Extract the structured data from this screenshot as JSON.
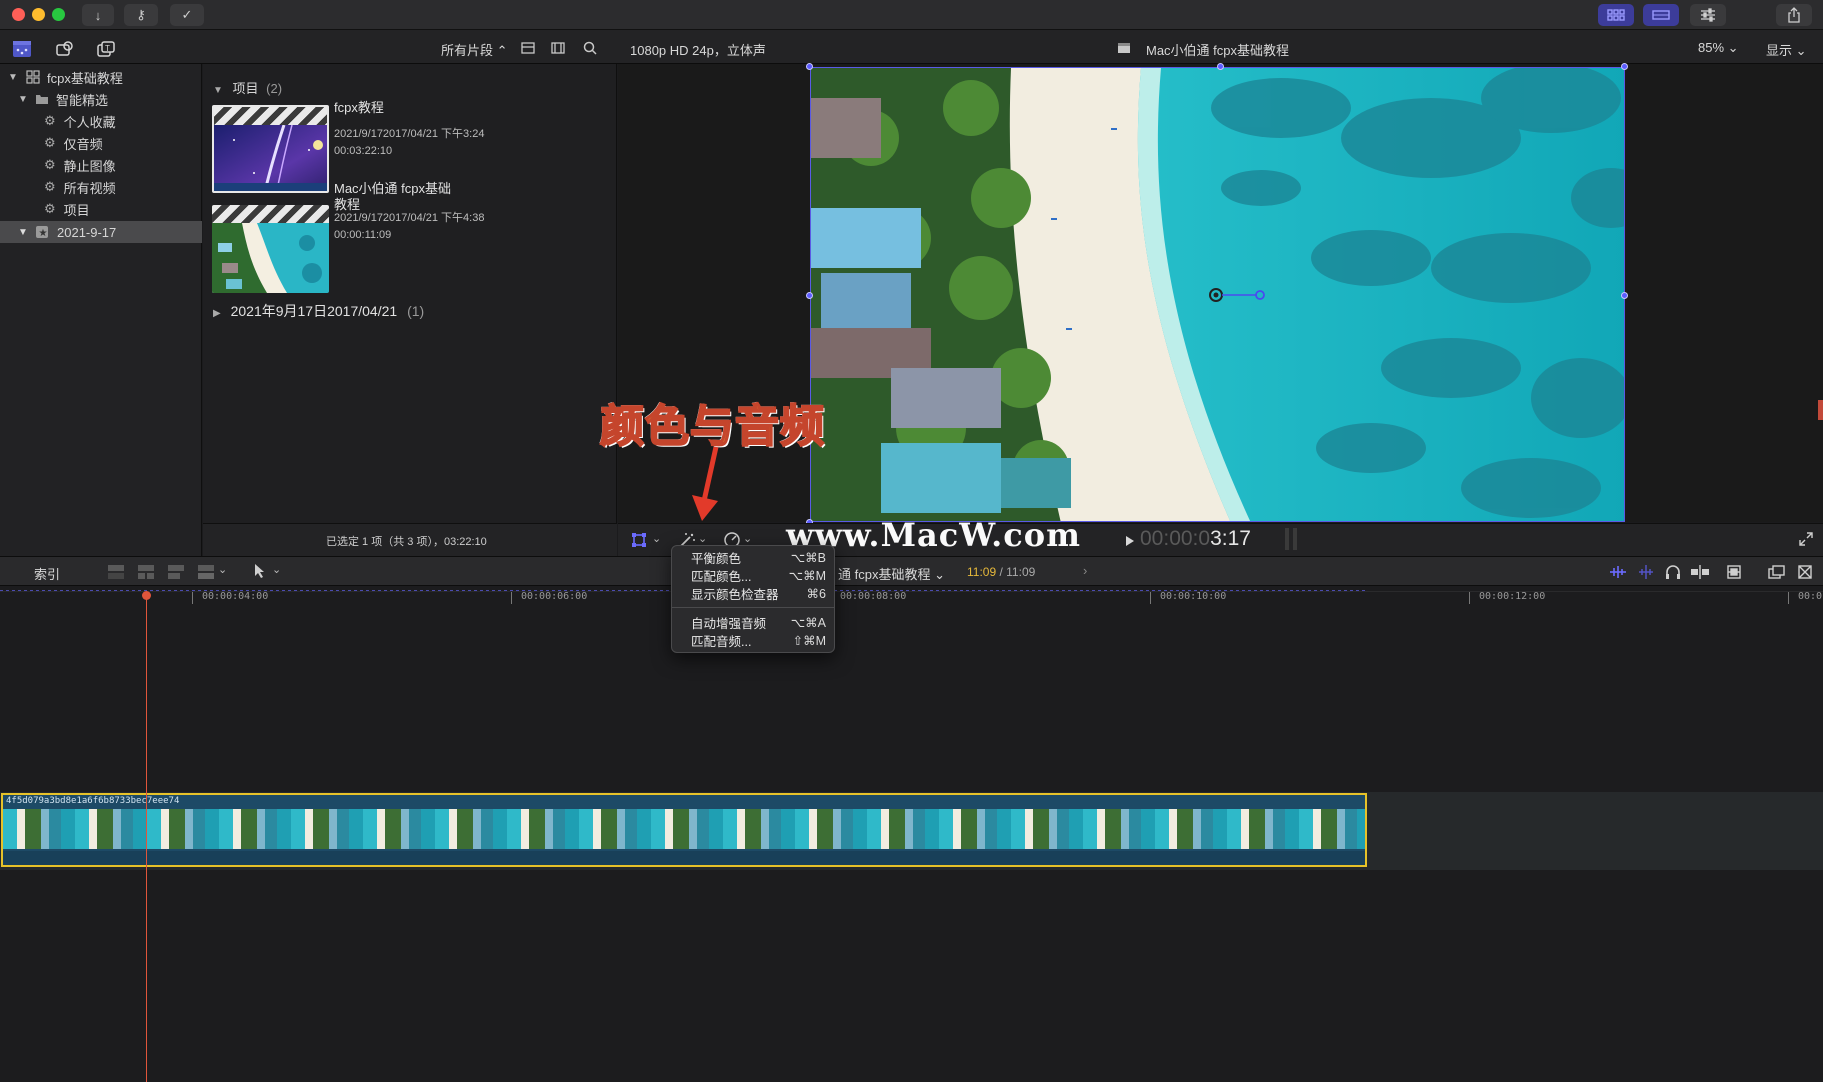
{
  "titlebar": {
    "traffic": [
      "#fe5f57",
      "#febc2e",
      "#28c840"
    ],
    "buttons": [
      "↓",
      "⚷",
      "✓"
    ],
    "right_icons": [
      "grid-icon",
      "filmstrip-icon",
      "sliders-icon",
      "share-icon"
    ]
  },
  "toolbar": {
    "clips_filter": "所有片段 ⌃",
    "viewer_format": "1080p HD 24p，立体声",
    "viewer_title": "Mac小伯通 fcpx基础教程",
    "zoom": "85% ⌄",
    "display": "显示 ⌄"
  },
  "sidebar": {
    "library": "fcpx基础教程",
    "smart_folder": "智能精选",
    "items": [
      "个人收藏",
      "仅音频",
      "静止图像",
      "所有视频",
      "项目"
    ],
    "event": "2021-9-17"
  },
  "browser": {
    "section_title": "项目",
    "section_count": "(2)",
    "clips": [
      {
        "name": "fcpx教程",
        "date": "2021/9/172017/04/21 下午3:24",
        "duration": "00:03:22:10"
      },
      {
        "name": "Mac小伯通 fcpx基础\n教程",
        "date": "2021/9/172017/04/21 下午4:38",
        "duration": "00:00:11:09"
      }
    ],
    "collapsed_section": "2021年9月17日2017/04/21",
    "collapsed_count": "(1)",
    "status": "已选定 1 项（共 3 项），03:22:10"
  },
  "viewer": {
    "timecode_dim": "00:00:0",
    "timecode": "3:17"
  },
  "timeline": {
    "index_label": "索引",
    "project_name": "通 fcpx基础教程 ⌄",
    "position": "11:09",
    "duration": "/ 11:09",
    "ruler": [
      "00:00:04:00",
      "00:00:06:00",
      "00:00:08:00",
      "00:00:10:00",
      "00:00:12:00",
      "00:0"
    ],
    "clip_name": "4f5d079a3bd8e1a6f6b8733bec7eee74"
  },
  "menu": {
    "items": [
      {
        "label": "平衡颜色",
        "shortcut": "⌥⌘B"
      },
      {
        "label": "匹配颜色...",
        "shortcut": "⌥⌘M"
      },
      {
        "label": "显示颜色检查器",
        "shortcut": "⌘6"
      },
      {
        "label": "自动增强音频",
        "shortcut": "⌥⌘A"
      },
      {
        "label": "匹配音频...",
        "shortcut": "⇧⌘M"
      }
    ]
  },
  "annotation": {
    "text": "颜色与音频",
    "watermark": "www.MacW.com"
  },
  "colors": {
    "accent": "#5c5cff",
    "playhead": "#e0553b",
    "clip_border": "#e6c229",
    "timecode_yellow": "#e6b93b"
  }
}
